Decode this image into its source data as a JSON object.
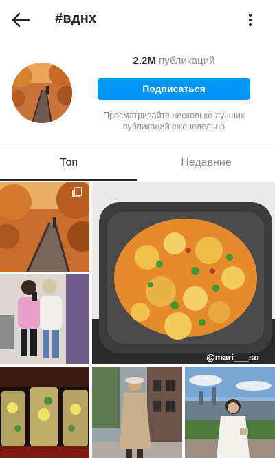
{
  "header": {
    "title": "#вднх",
    "back_icon": "arrow-left-icon",
    "more_icon": "more-vertical-icon"
  },
  "profile": {
    "posts_count": "2.2M",
    "posts_label": "публикаций",
    "follow_label": "Подписаться",
    "hint": "Просматривайте несколько лучших публикаций еженедельно"
  },
  "tabs": {
    "top_label": "Топ",
    "recent_label": "Недавние",
    "active": "top"
  },
  "grid": {
    "watermark": "@mari___so",
    "tiles": [
      {
        "name": "autumn-boardwalk-photo",
        "multi": true
      },
      {
        "name": "stew-pot-photo"
      },
      {
        "name": "two-women-mirror-selfie-photo"
      },
      {
        "name": "cocktails-photo"
      },
      {
        "name": "woman-on-street-photo"
      },
      {
        "name": "woman-skyline-photo"
      }
    ]
  },
  "colors": {
    "accent": "#0095f6",
    "text": "#262626",
    "muted": "#8e8e8e",
    "divider": "#dbdbdb"
  }
}
